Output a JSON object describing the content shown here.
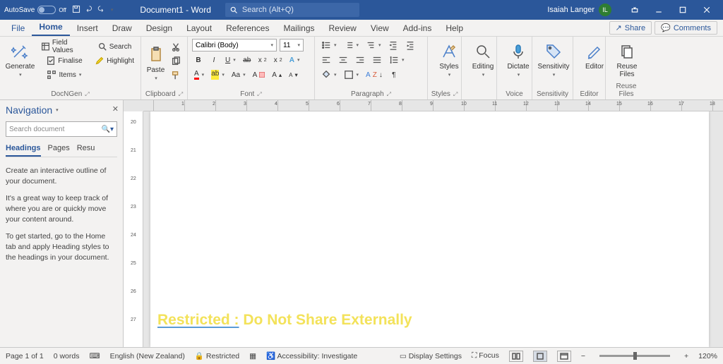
{
  "titlebar": {
    "autosave_label": "AutoSave",
    "autosave_state": "Off",
    "doc_title": "Document1 - Word",
    "search_placeholder": "Search (Alt+Q)",
    "user_name": "Isaiah Langer",
    "user_initials": "IL"
  },
  "tabs": {
    "file": "File",
    "home": "Home",
    "insert": "Insert",
    "draw": "Draw",
    "design": "Design",
    "layout": "Layout",
    "references": "References",
    "mailings": "Mailings",
    "review": "Review",
    "view": "View",
    "addins": "Add-ins",
    "help": "Help",
    "share": "Share",
    "comments": "Comments"
  },
  "ribbon": {
    "docngen": {
      "generate": "Generate",
      "field_values": "Field Values",
      "finalise": "Finalise",
      "items": "Items",
      "search": "Search",
      "highlight": "Highlight",
      "label": "DocNGen"
    },
    "clipboard": {
      "paste": "Paste",
      "label": "Clipboard"
    },
    "font": {
      "name": "Calibri (Body)",
      "size": "11",
      "label": "Font"
    },
    "paragraph": {
      "label": "Paragraph"
    },
    "styles": {
      "btn": "Styles",
      "label": "Styles"
    },
    "editing": {
      "btn": "Editing"
    },
    "voice": {
      "dictate": "Dictate",
      "label": "Voice"
    },
    "sensitivity": {
      "btn": "Sensitivity",
      "label": "Sensitivity"
    },
    "editor": {
      "btn": "Editor",
      "label": "Editor"
    },
    "reuse": {
      "btn": "Reuse Files",
      "label": "Reuse Files"
    }
  },
  "nav": {
    "title": "Navigation",
    "search_placeholder": "Search document",
    "tabs": {
      "headings": "Headings",
      "pages": "Pages",
      "results": "Resu"
    },
    "p1": "Create an interactive outline of your document.",
    "p2": "It's a great way to keep track of where you are or quickly move your content around.",
    "p3": "To get started, go to the Home tab and apply Heading styles to the headings in your document."
  },
  "doc": {
    "watermark_a": "Restricted :",
    "watermark_b": " Do Not Share Externally"
  },
  "status": {
    "page": "Page 1 of 1",
    "words": "0 words",
    "lang": "English (New Zealand)",
    "restricted": "Restricted",
    "accessibility": "Accessibility: Investigate",
    "display": "Display Settings",
    "focus": "Focus",
    "zoom": "120%"
  }
}
